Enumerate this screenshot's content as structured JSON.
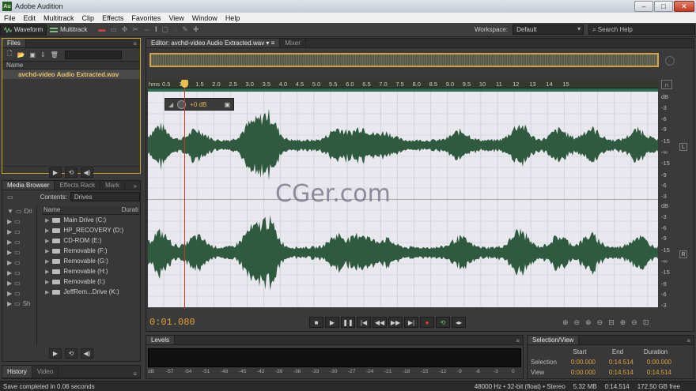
{
  "window": {
    "title": "Adobe Audition",
    "app_icon": "Au",
    "controls": {
      "minimize": "–",
      "maximize": "□",
      "close": "✕"
    }
  },
  "menu": [
    "File",
    "Edit",
    "Multitrack",
    "Clip",
    "Effects",
    "Favorites",
    "View",
    "Window",
    "Help"
  ],
  "toolbar": {
    "waveform_label": "Waveform",
    "multitrack_label": "Multitrack",
    "workspace_label": "Workspace:",
    "workspace_value": "Default",
    "search_placeholder": "Search Help"
  },
  "files_panel": {
    "tab": "Files",
    "column_name": "Name",
    "file": "avchd-video Audio Extracted.wav"
  },
  "media_panel": {
    "tabs": [
      "Media Browser",
      "Effects Rack",
      "Mark"
    ],
    "contents_label": "Contents:",
    "contents_value": "Drives",
    "tree_items": [
      "Dri",
      "Sh"
    ],
    "col_name": "Name",
    "col_duration": "Durati",
    "drives": [
      "Main Drive (C:)",
      "HP_RECOVERY (D:)",
      "CD-ROM (E:)",
      "Removable (F:)",
      "Removable (G:)",
      "Removable (H:)",
      "Removable (I:)",
      "JeffRem...Drive (K:)"
    ]
  },
  "history_panel": {
    "tabs": [
      "History",
      "Video"
    ]
  },
  "editor": {
    "tab": "Editor: avchd-video Audio Extracted.wav",
    "mixer_tab": "Mixer",
    "ruler_unit": "hms",
    "ruler_ticks": [
      "0.5",
      "1.0",
      "1.5",
      "2.0",
      "2.5",
      "3.0",
      "3.5",
      "4.0",
      "4.5",
      "5.0",
      "5.5",
      "6.0",
      "6.5",
      "7.0",
      "7.5",
      "8.0",
      "8.5",
      "9.0",
      "9.5",
      "10",
      "11",
      "12",
      "13",
      "14",
      "15"
    ],
    "hud_gain": "+0 dB",
    "db_scale_top": [
      "dB",
      "-3",
      "-6",
      "-9",
      "-15",
      "-∞",
      "-15",
      "-9",
      "-6",
      "-3"
    ],
    "db_scale_bottom": [
      "dB",
      "-3",
      "-6",
      "-9",
      "-15",
      "-∞",
      "-15",
      "-9",
      "-6",
      "-3"
    ],
    "channel_left": "L",
    "channel_right": "R",
    "timecode": "0:01.080",
    "waveform_color": "#2f5a3f"
  },
  "levels_panel": {
    "tab": "Levels",
    "scale": [
      "dB",
      "-57",
      "-54",
      "-51",
      "-48",
      "-45",
      "-42",
      "-39",
      "-36",
      "-33",
      "-30",
      "-27",
      "-24",
      "-21",
      "-18",
      "-15",
      "-12",
      "-9",
      "-6",
      "-3",
      "0"
    ]
  },
  "selection_panel": {
    "tab": "Selection/View",
    "headers": [
      "Start",
      "End",
      "Duration"
    ],
    "selection_label": "Selection",
    "selection": [
      "0:00.000",
      "0:14.514",
      "0:00.000"
    ],
    "view_label": "View",
    "view": [
      "0:00.000",
      "0:14.514",
      "0:14.514"
    ]
  },
  "status": {
    "message": "Save completed in 0.06 seconds",
    "format": "48000 Hz • 32-bit (float) • Stereo",
    "size": "5.32 MB",
    "duration": "0:14.514",
    "free": "172.50 GB free"
  },
  "watermark": "CGer.com"
}
